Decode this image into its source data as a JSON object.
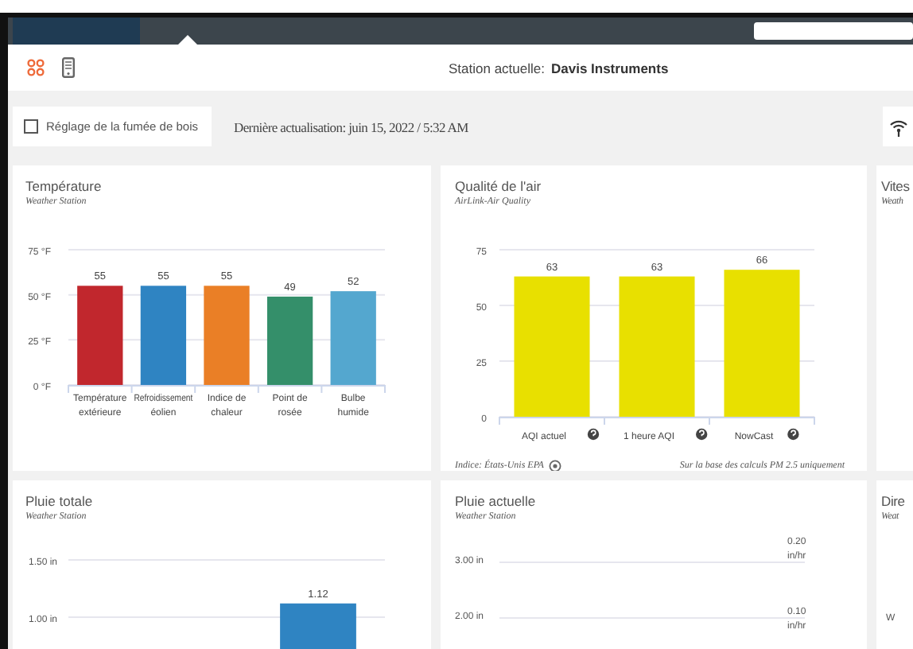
{
  "toolbar": {
    "station_label": "Station actuelle:",
    "station_name": "Davis Instruments"
  },
  "filter": {
    "wood_smoke": {
      "label": "Réglage de la fumée de bois",
      "checked": false
    },
    "last_update": "Dernière actualisation: juin 15, 2022 / 5:32 AM"
  },
  "cards": [
    {
      "title": "Température",
      "subtitle": "Weather Station",
      "bars": [
        {
          "color": "#c1272d"
        },
        {
          "color": "#2f84c2"
        },
        {
          "color": "#ea7f26"
        },
        {
          "color": "#348f6a"
        },
        {
          "color": "#54a7cf"
        }
      ],
      "chart_data": {
        "type": "bar",
        "categories": [
          "Température extérieure",
          "Refroidissement éolien",
          "Indice de chaleur",
          "Point de rosée",
          "Bulbe humide"
        ],
        "ylim": [
          0,
          75
        ],
        "yticks": [
          {
            "value": 0,
            "label": "0 °F"
          },
          {
            "value": 25,
            "label": "25 °F"
          },
          {
            "value": 50,
            "label": "50 °F"
          },
          {
            "value": 75,
            "label": "75 °F"
          }
        ],
        "data_labels": true,
        "series": [
          {
            "values": [
              55,
              55,
              55,
              49,
              52
            ]
          }
        ]
      }
    },
    {
      "title": "Qualité de l'air",
      "subtitle": "AirLink-Air Quality",
      "chart_data": {
        "type": "bar",
        "categories": [
          "AQI actuel",
          "1 heure AQI",
          "NowCast"
        ],
        "ylim": [
          0,
          75
        ],
        "yticks": [
          0,
          25,
          50,
          75
        ],
        "data_labels": true,
        "series": [
          {
            "color": "#e8e000",
            "values": [
              63,
              63,
              66
            ]
          }
        ]
      },
      "footer_left": "Indice: États-Unis EPA",
      "footer_right": "Sur la base des calculs PM 2.5 uniquement"
    },
    {
      "title": "Vites",
      "subtitle": "Weath"
    },
    {
      "title": "Pluie totale",
      "subtitle": "Weather Station",
      "chart_data": {
        "type": "bar",
        "ylim": [
          0,
          1.5
        ],
        "yticks": [
          {
            "value": 1,
            "label": "1.00 in"
          },
          {
            "value": 1.5,
            "label": "1.50 in"
          }
        ],
        "data_labels": true,
        "series": [
          {
            "color": "#2f84c2",
            "values": [
              1.12
            ]
          }
        ]
      }
    },
    {
      "title": "Pluie actuelle",
      "subtitle": "Weather Station",
      "left_axis_labels": [
        "3.00 in",
        "2.00 in"
      ],
      "right_axis_labels": [
        "0.20 in/hr",
        "0.10 in/hr"
      ]
    },
    {
      "title": "Dire",
      "subtitle": "Weat",
      "axis_label": "W"
    }
  ]
}
